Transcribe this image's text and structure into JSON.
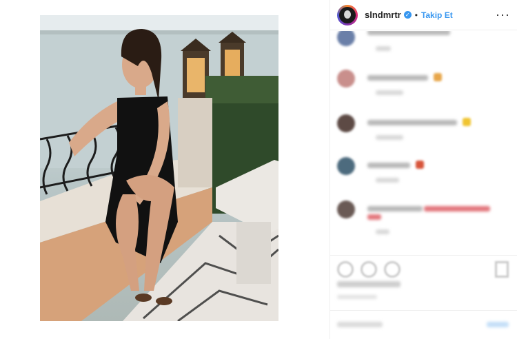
{
  "post": {
    "author": {
      "username": "slndmrtr",
      "verified_mark": "✓",
      "verified_icon": "verified-badge-icon",
      "separator": "•",
      "follow_label": "Takip Et",
      "more_label": "···"
    },
    "colors": {
      "accent": "#3897f0",
      "border": "#efefef",
      "text": "#262626"
    }
  }
}
